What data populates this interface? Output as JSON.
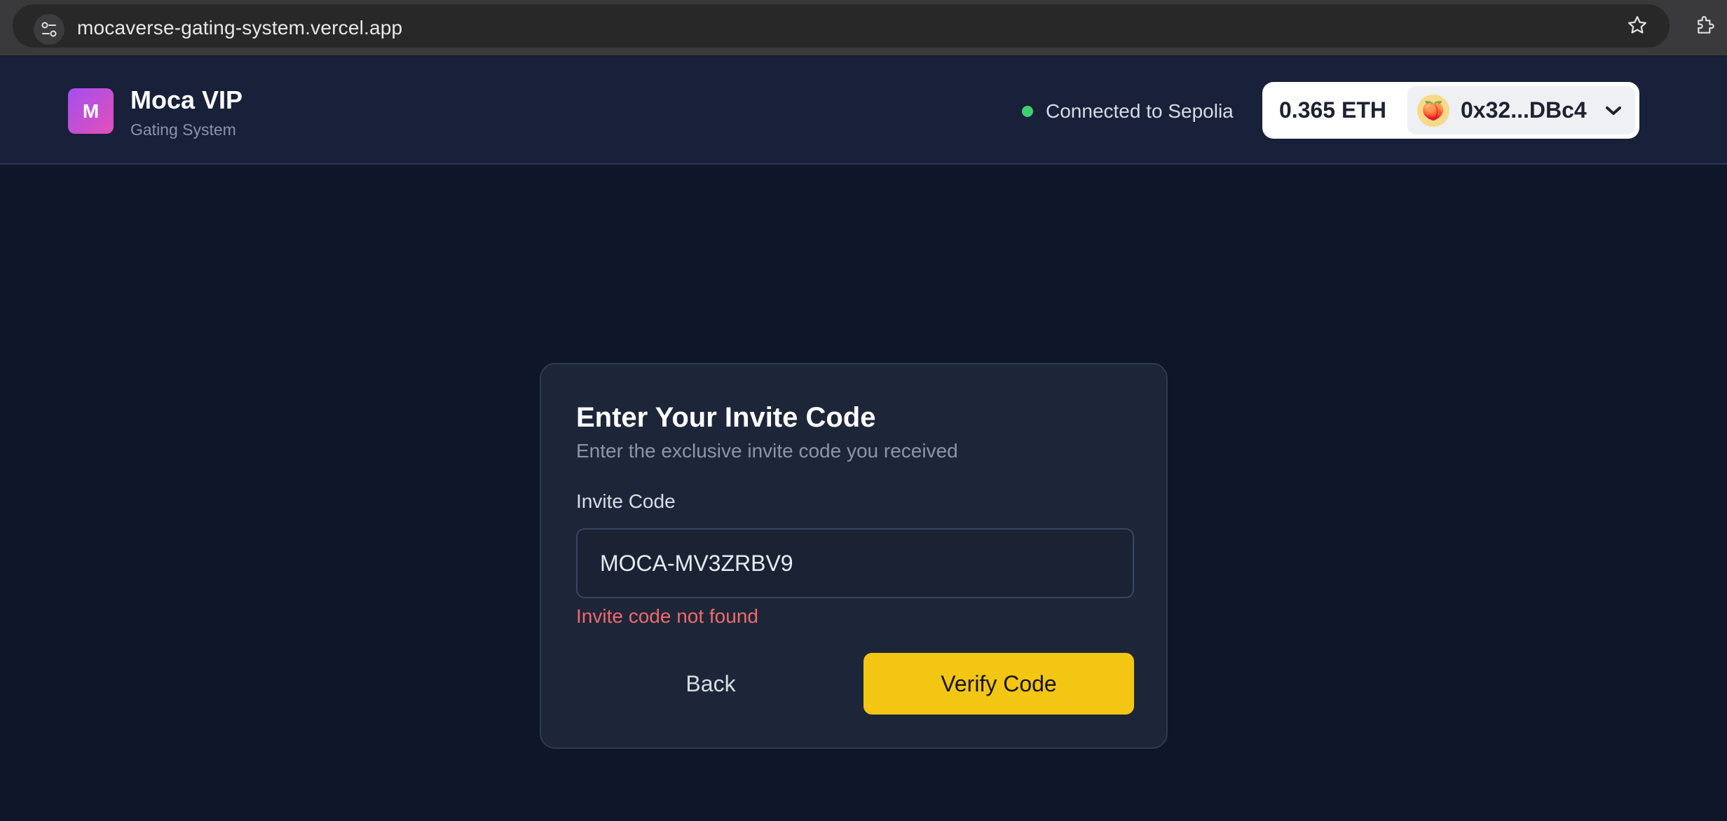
{
  "browser": {
    "url": "mocaverse-gating-system.vercel.app",
    "icons": [
      "site-settings-icon",
      "star-icon",
      "extensions-icon"
    ]
  },
  "header": {
    "logo_letter": "M",
    "title": "Moca VIP",
    "subtitle": "Gating System",
    "network_status": "Connected to Sepolia",
    "network_status_color": "#3ecf6f",
    "wallet": {
      "balance": "0.365 ETH",
      "avatar_emoji": "🍑",
      "address": "0x32...DBc4"
    }
  },
  "card": {
    "title": "Enter Your Invite Code",
    "subtitle": "Enter the exclusive invite code you received",
    "field_label": "Invite Code",
    "field_value": "MOCA-MV3ZRBV9",
    "error": "Invite code not found",
    "back_label": "Back",
    "verify_label": "Verify Code"
  },
  "colors": {
    "background": "#0f1629",
    "header": "#18203a",
    "card": "#1d2639",
    "accent": "#f3c614",
    "error": "#f06a6a",
    "logo_gradient": [
      "#a44ff0",
      "#e24fb8"
    ]
  }
}
